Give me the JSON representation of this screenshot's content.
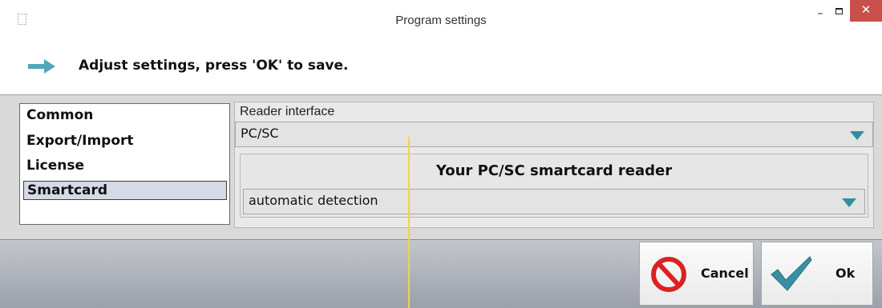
{
  "window": {
    "title": "Program settings"
  },
  "header": {
    "text": "Adjust settings, press 'OK' to save."
  },
  "nav": {
    "items": [
      {
        "label": "Common"
      },
      {
        "label": "Export/Import"
      },
      {
        "label": "License"
      },
      {
        "label": "Smartcard"
      }
    ],
    "selected": "Smartcard"
  },
  "reader": {
    "label": "Reader interface",
    "value": "PC/SC"
  },
  "smartcard": {
    "title": "Your PC/SC smartcard reader",
    "reader_value": "automatic detection"
  },
  "buttons": {
    "cancel": "Cancel",
    "ok": "Ok"
  },
  "colors": {
    "accent_arrow": "#4fa7b8",
    "dropdown_arrow": "#2f8ea2",
    "close_button": "#c7504a",
    "selection": "#d4dbe6",
    "cancel_icon": "#d92222",
    "check_icon": "#3a8fa3"
  }
}
